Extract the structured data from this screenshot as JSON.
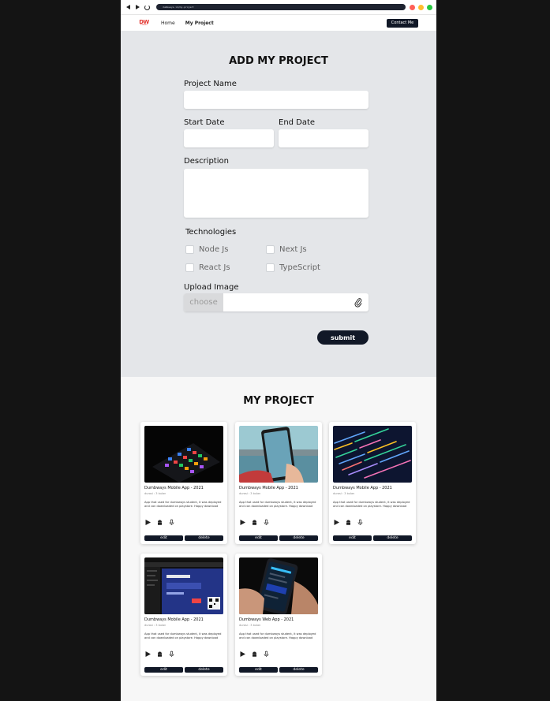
{
  "browser": {
    "url": "dumbways.id/my-project",
    "dot_colors": [
      "#ff5f57",
      "#febc2e",
      "#28c840"
    ]
  },
  "navbar": {
    "logo_text": "DW",
    "logo_subtext": "DUMBWAYS",
    "links": [
      "Home",
      "My Project"
    ],
    "contact_label": "Contact Me"
  },
  "form": {
    "title": "ADD MY PROJECT",
    "project_name_label": "Project Name",
    "start_date_label": "Start Date",
    "end_date_label": "End Date",
    "description_label": "Description",
    "technologies_label": "Technologies",
    "technologies": [
      "Node Js",
      "Next Js",
      "React Js",
      "TypeScript"
    ],
    "upload_label": "Upload Image",
    "choose_label": "choose",
    "submit_label": "submit"
  },
  "projects_section": {
    "title": "MY PROJECT",
    "edit_label": "edit",
    "delete_label": "delete",
    "cards": [
      {
        "title": "Dumbways Mobile App - 2021",
        "duration": "durasi : 3 bulan",
        "description": "App that used for dumbways student, it was deployed and can downloaded on playstore. Happy download"
      },
      {
        "title": "Dumbways Mobile App - 2021",
        "duration": "durasi : 3 bulan",
        "description": "App that used for dumbways student, it was deployed and can downloaded on playstore. Happy download"
      },
      {
        "title": "Dumbways Mobile App - 2021",
        "duration": "durasi : 3 bulan",
        "description": "App that used for dumbways student, it was deployed and can downloaded on playstore. Happy download"
      },
      {
        "title": "Dumbways Mobile App - 2021",
        "duration": "durasi : 3 bulan",
        "description": "App that used for dumbways student, it was deployed and can downloaded on playstore. Happy download"
      },
      {
        "title": "Dumbways Web App - 2021",
        "duration": "durasi : 3 bulan",
        "description": "App that used for dumbways student, it was deployed and can downloaded on playstore. Happy download"
      }
    ]
  },
  "icons": {
    "card_tech": [
      "play-store-icon",
      "android-icon",
      "microphone-icon"
    ],
    "upload": "paperclip-icon"
  },
  "colors": {
    "dark": "#111827",
    "form_bg": "#e4e6e9",
    "brand": "#e3342f"
  }
}
